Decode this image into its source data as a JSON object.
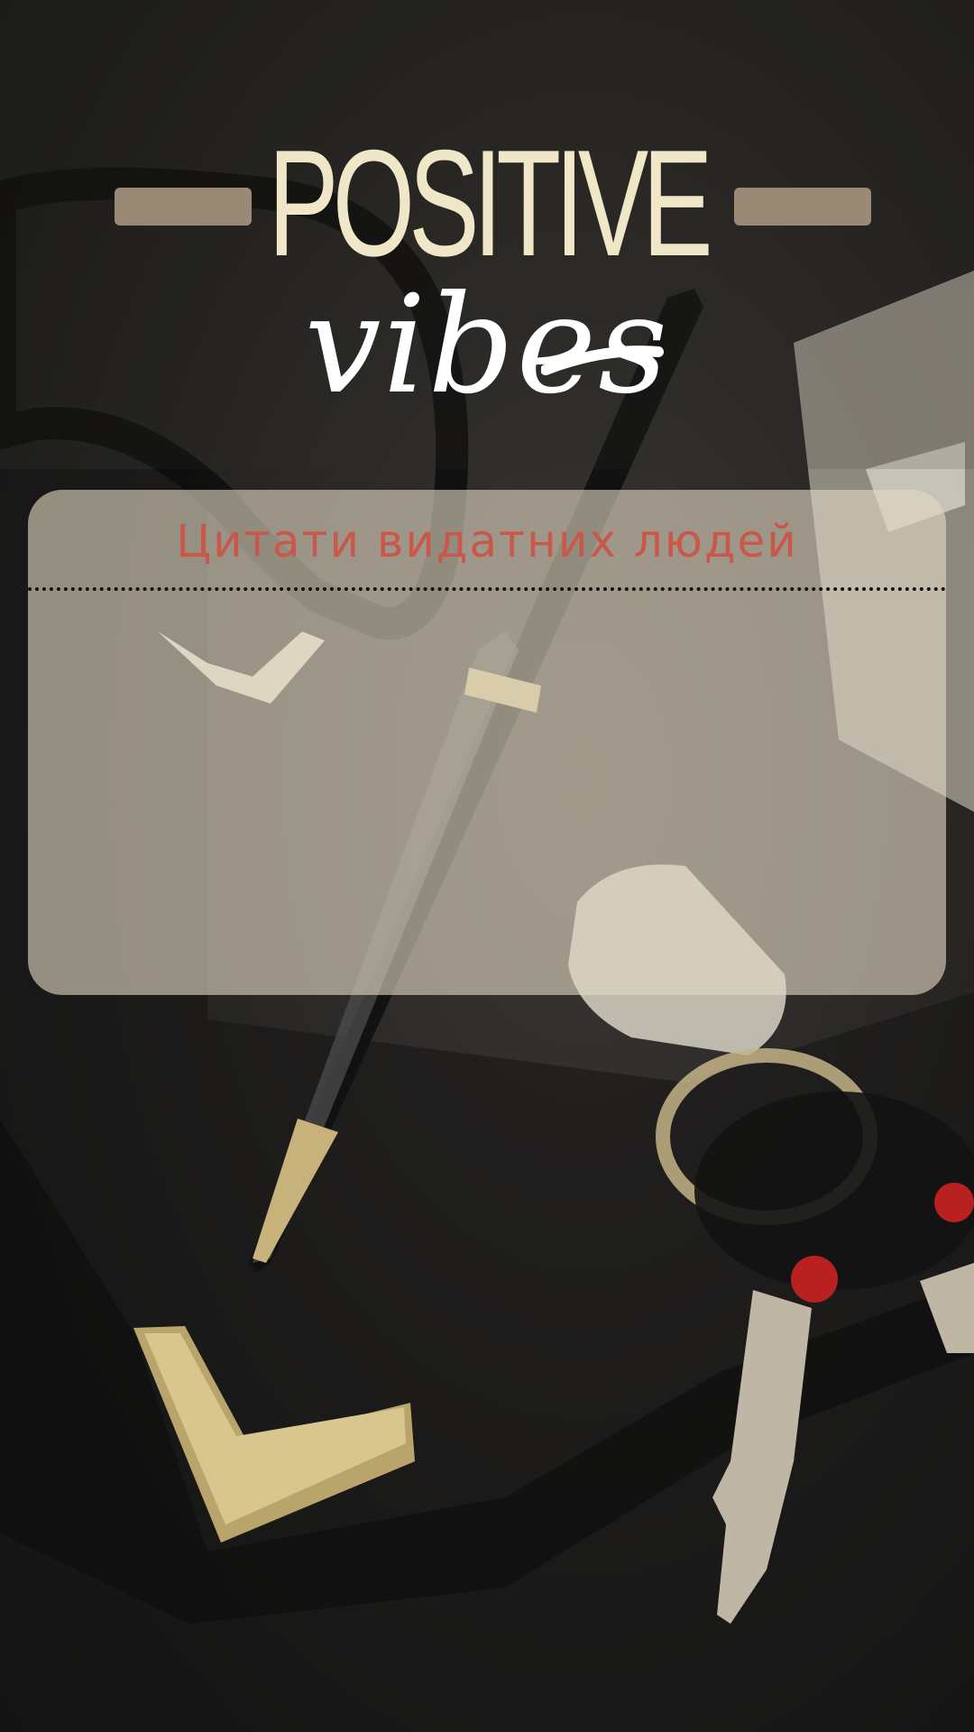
{
  "header": {
    "title_line1": "POSITIVE",
    "title_line2": "vibes"
  },
  "card": {
    "title": "Цитати видатних людей",
    "title_color": "#c9574a",
    "quote_text": ""
  },
  "colors": {
    "title_cream": "#efe7c8",
    "bar_tan": "#9a8a75",
    "card_bg": "#e2d9c4"
  }
}
